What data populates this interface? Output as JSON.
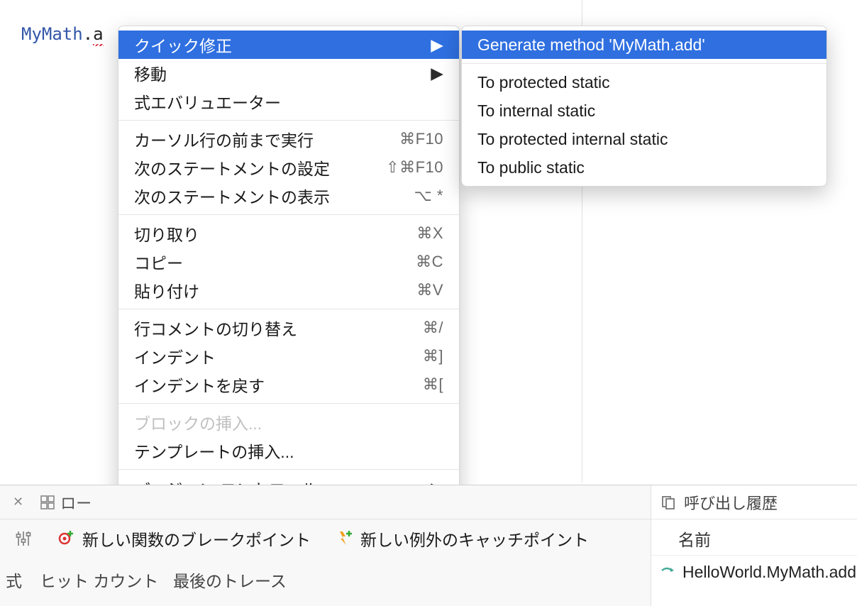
{
  "code": {
    "typeName": "MyMath",
    "dot": ".",
    "partial": "a"
  },
  "contextMenu": {
    "groups": [
      [
        {
          "key": "quickfix",
          "label": "クイック修正",
          "arrow": true,
          "highlight": true
        },
        {
          "key": "navigate",
          "label": "移動",
          "arrow": true
        },
        {
          "key": "eval",
          "label": "式エバリュエーター"
        }
      ],
      [
        {
          "key": "runto",
          "label": "カーソル行の前まで実行",
          "shortcut": "⌘F10"
        },
        {
          "key": "setnext",
          "label": "次のステートメントの設定",
          "shortcut": "⇧⌘F10"
        },
        {
          "key": "shownext",
          "label": "次のステートメントの表示",
          "shortcut": "⌥ *"
        }
      ],
      [
        {
          "key": "cut",
          "label": "切り取り",
          "shortcut": "⌘X"
        },
        {
          "key": "copy",
          "label": "コピー",
          "shortcut": "⌘C"
        },
        {
          "key": "paste",
          "label": "貼り付け",
          "shortcut": "⌘V"
        }
      ],
      [
        {
          "key": "togglecmt",
          "label": "行コメントの切り替え",
          "shortcut": "⌘/"
        },
        {
          "key": "indent",
          "label": "インデント",
          "shortcut": "⌘]"
        },
        {
          "key": "unindent",
          "label": "インデントを戻す",
          "shortcut": "⌘["
        }
      ],
      [
        {
          "key": "insblock",
          "label": "ブロックの挿入...",
          "disabled": true
        },
        {
          "key": "instpl",
          "label": "テンプレートの挿入..."
        }
      ],
      [
        {
          "key": "vcs",
          "label": "バージョン コントロール",
          "arrow": true
        }
      ]
    ]
  },
  "quickFixSub": {
    "top": [
      {
        "key": "genmethod",
        "label": "Generate method 'MyMath.add'",
        "highlight": true
      }
    ],
    "rest": [
      {
        "key": "protstatic",
        "label": "To protected static"
      },
      {
        "key": "intstatic",
        "label": "To internal static"
      },
      {
        "key": "protintstatic",
        "label": "To protected internal static"
      },
      {
        "key": "pubstatic",
        "label": "To public static"
      }
    ]
  },
  "bottom": {
    "tabLocalsFragment": "ロー",
    "toolbar": {
      "newFuncBp": "新しい関数のブレークポイント",
      "newExCatch": "新しい例外のキャッチポイント"
    },
    "colsFragment": {
      "a": "式",
      "b": "ヒット カウント",
      "c": "最後のトレース"
    }
  },
  "callHistory": {
    "title": "呼び出し履歴",
    "colName": "名前",
    "entry": "HelloWorld.MyMath.add("
  }
}
